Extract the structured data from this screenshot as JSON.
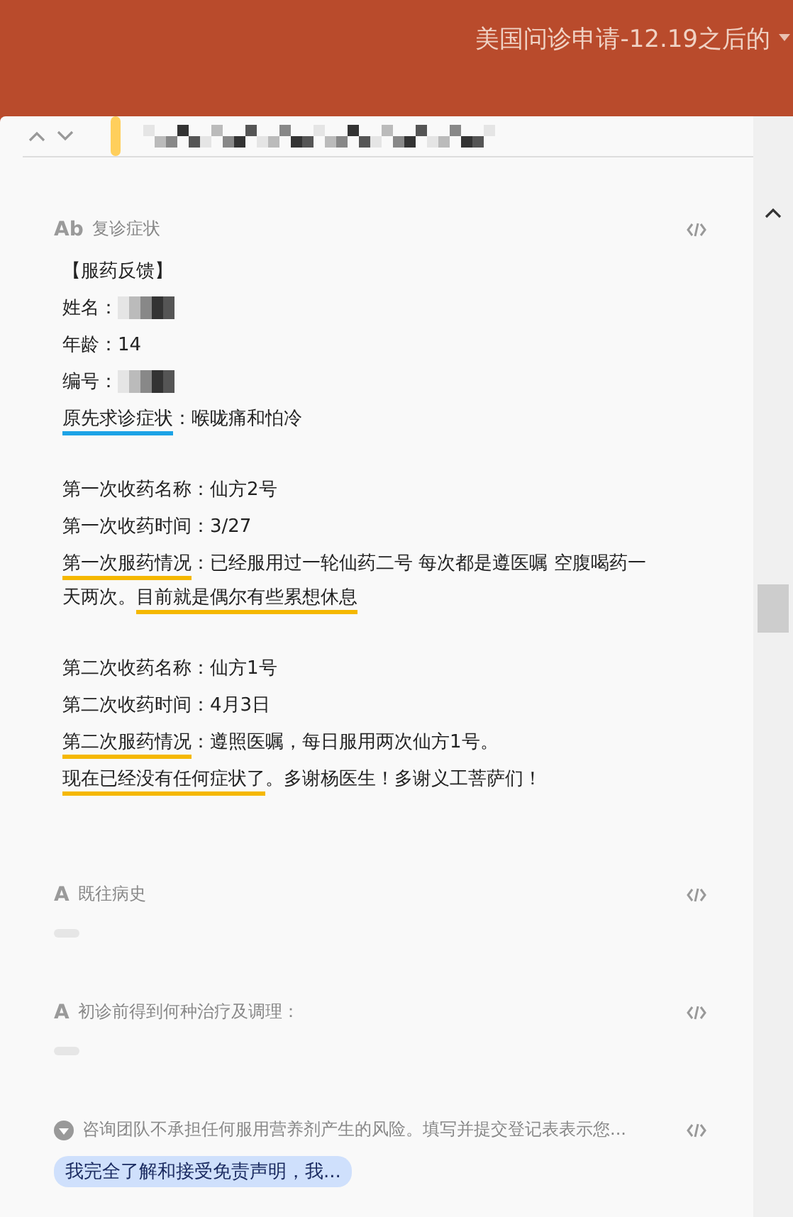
{
  "header": {
    "title": "美国问诊申请-12.19之后的"
  },
  "sections": [
    {
      "kind": "text",
      "icon_glyph": "Ab",
      "label": "复诊症状",
      "paragraphs": [
        [
          [
            {
              "text": "【服药反馈】"
            }
          ],
          [
            {
              "text": "姓名："
            },
            {
              "redacted": true
            }
          ],
          [
            {
              "text": "年龄：14"
            }
          ],
          [
            {
              "text": "编号："
            },
            {
              "redacted": true
            }
          ],
          [
            {
              "text": "原先求诊症状",
              "color": "#1ca3e6"
            },
            {
              "text": "：喉咙痛和怕冷"
            }
          ]
        ],
        [
          [
            {
              "text": "第一次收药名称：仙方2号"
            }
          ],
          [
            {
              "text": "第一次收药时间：3/27"
            }
          ],
          [
            {
              "text": "第一次服药情况",
              "color": "#f5b800"
            },
            {
              "text": "：已经服用过一轮仙药二号 每次都是遵医嘱 空腹喝药一天两次。"
            },
            {
              "text": "目前就是偶尔有些累想休息",
              "color": "#f5b800"
            }
          ]
        ],
        [
          [
            {
              "text": "第二次收药名称：仙方1号"
            }
          ],
          [
            {
              "text": "第二次收药时间：4月3日"
            }
          ],
          [
            {
              "text": "第二次服药情况",
              "color": "#f5b800"
            },
            {
              "text": "：遵照医嘱，每日服用两次仙方1号。"
            }
          ],
          [
            {
              "text": "现在已经没有任何症状了",
              "color": "#f5b800"
            },
            {
              "text": "。多谢杨医生！多谢义工菩萨们！"
            }
          ]
        ]
      ]
    },
    {
      "kind": "empty",
      "icon_glyph": "A",
      "label": "既往病史"
    },
    {
      "kind": "empty",
      "icon_glyph": "A",
      "label": "初诊前得到何种治疗及调理："
    },
    {
      "kind": "choice",
      "label": "咨询团队不承担任何服用营养剂产生的风险。填写并提交登记表表示您...",
      "option": {
        "text": "我完全了解和接受免责声明，我...",
        "selected": true
      }
    }
  ]
}
